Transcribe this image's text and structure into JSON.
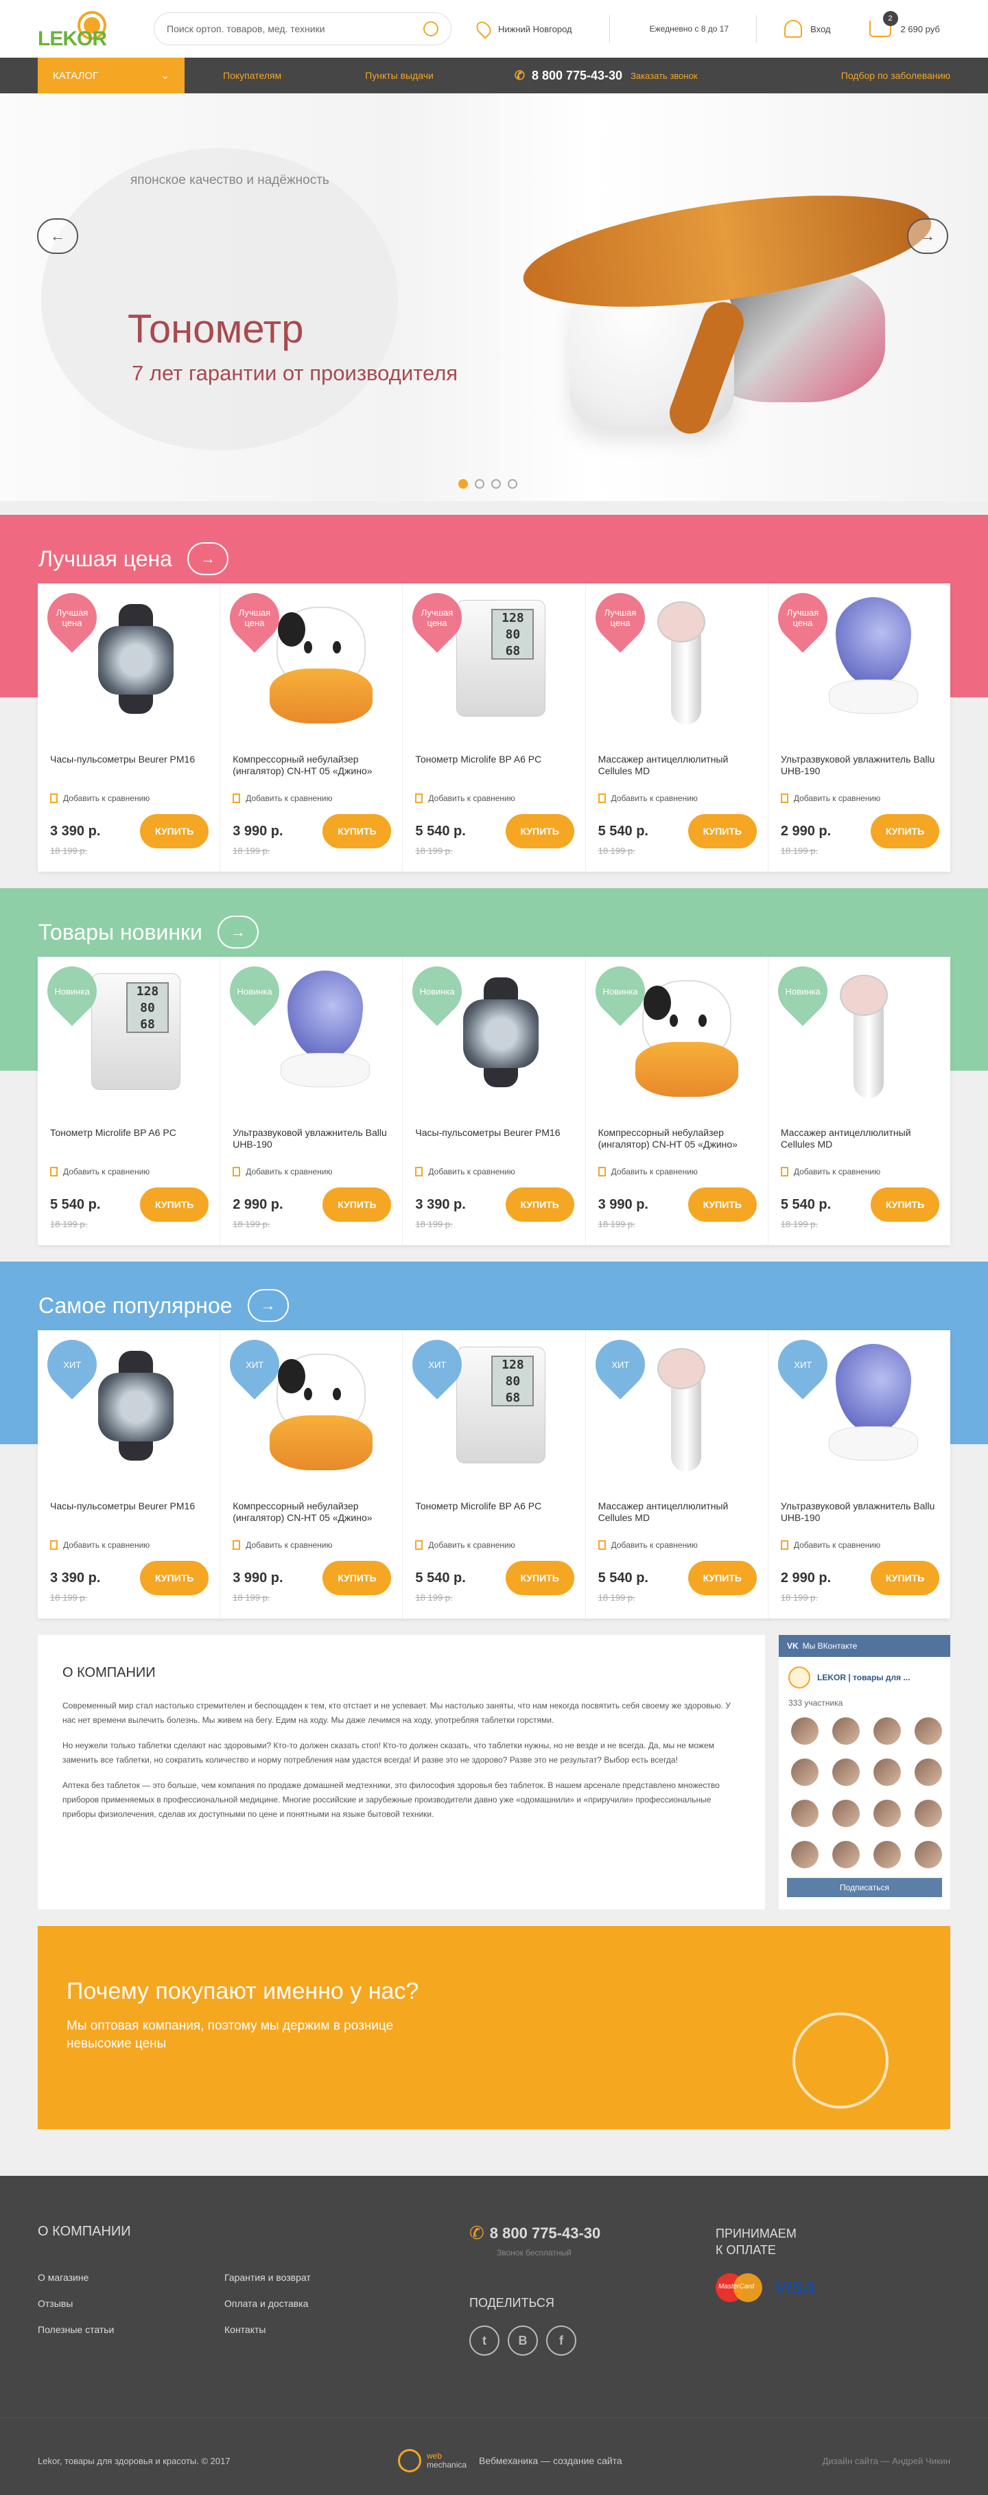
{
  "header": {
    "logo": "LEKOR",
    "search_placeholder": "Поиск ортоп. товаров, мед. техники",
    "city": "Нижний Новгород",
    "hours": "Ежедневно с 8 до 17",
    "login": "Вход",
    "cart_count": "2",
    "cart_total": "2 690 руб"
  },
  "nav": {
    "catalog": "КАТАЛОГ",
    "buyers": "Покупателям",
    "pickup": "Пункты выдачи",
    "phone": "8 800 775-43-30",
    "call": "Заказать звонок",
    "by_disease": "Подбор по заболеванию"
  },
  "hero": {
    "tagline": "японское качество и надёжность",
    "title": "Тонометр",
    "subtitle": "7 лет гарантии от производителя",
    "active_slide": 1,
    "slide_count": 4
  },
  "labels": {
    "compare": "Добавить к сравнению",
    "buy": "КУПИТЬ",
    "old_price": "18 199 р."
  },
  "sections": [
    {
      "title": "Лучшая цена",
      "color": "#ef6a80",
      "badge": "Лучшая цена",
      "products": [
        {
          "name": "Часы-пульсометры Beurer PM16",
          "price": "3 390 р.",
          "img": "watch"
        },
        {
          "name": "Компрессорный небулайзер (ингалятор) CN-HT 05 «Джино»",
          "price": "3 990 р.",
          "img": "cow"
        },
        {
          "name": "Тонометр Microlife BP A6 PC",
          "price": "5 540 р.",
          "img": "bpm"
        },
        {
          "name": "Массажер антицеллюлитный Cellules MD",
          "price": "5 540 р.",
          "img": "mass"
        },
        {
          "name": "Ультразвуковой увлажнитель Ballu UHB-190",
          "price": "2 990 р.",
          "img": "hum"
        }
      ]
    },
    {
      "title": "Товары новинки",
      "color": "#8fcfa7",
      "badge": "Новинка",
      "products": [
        {
          "name": "Тонометр Microlife BP A6 PC",
          "price": "5 540 р.",
          "img": "bpm"
        },
        {
          "name": "Ультразвуковой увлажнитель Ballu UHB-190",
          "price": "2 990 р.",
          "img": "hum"
        },
        {
          "name": "Часы-пульсометры Beurer PM16",
          "price": "3 390 р.",
          "img": "watch"
        },
        {
          "name": "Компрессорный небулайзер (ингалятор) CN-HT 05 «Джино»",
          "price": "3 990 р.",
          "img": "cow"
        },
        {
          "name": "Массажер антицеллюлитный Cellules MD",
          "price": "5 540 р.",
          "img": "mass"
        }
      ]
    },
    {
      "title": "Самое популярное",
      "color": "#6dafe0",
      "badge": "ХИТ",
      "products": [
        {
          "name": "Часы-пульсометры Beurer PM16",
          "price": "3 390 р.",
          "img": "watch"
        },
        {
          "name": "Компрессорный небулайзер (ингалятор) CN-HT 05 «Джино»",
          "price": "3 990 р.",
          "img": "cow"
        },
        {
          "name": "Тонометр Microlife BP A6 PC",
          "price": "5 540 р.",
          "img": "bpm"
        },
        {
          "name": "Массажер антицеллюлитный Cellules MD",
          "price": "5 540 р.",
          "img": "mass"
        },
        {
          "name": "Ультразвуковой увлажнитель Ballu UHB-190",
          "price": "2 990 р.",
          "img": "hum"
        }
      ]
    }
  ],
  "about": {
    "title": "О КОМПАНИИ",
    "p1": "Современный мир стал настолько стремителен и беспощаден к тем, кто отстает и не успевает. Мы настолько заняты, что нам некогда посвятить себя своему же здоровью. У нас нет времени вылечить болезнь. Мы живем на бегу. Едим на ходу. Мы даже лечимся на ходу, употребляя таблетки горстями.",
    "p2": "Но неужели только таблетки сделают нас здоровыми? Кто-то должен сказать стоп! Кто-то должен сказать, что таблетки нужны, но не везде и не всегда. Да, мы не можем заменить все таблетки, но сократить количество и норму потребления нам удастся всегда! И разве это не здорово? Разве это не результат? Выбор есть всегда!",
    "p3": "Аптека без таблеток — это больше, чем компания по продаже домашней медтехники, это философия здоровья без таблеток. В нашем арсенале представлено множество приборов применяемых в профессиональной медицине. Многие российские и зарубежные производители давно уже «одомашнили» и «приручили» профессиональные приборы физиолечения, сделав их доступными по цене и понятными на языке бытовой техники."
  },
  "vk": {
    "header": "Мы ВКонтакте",
    "group": "LEKOR | товары для ...",
    "members": "333 участника",
    "subscribe": "Подписаться"
  },
  "why": {
    "title": "Почему покупают именно у нас?",
    "text": "Мы оптовая компания, поэтому мы держим в рознице невысокие цены"
  },
  "footer": {
    "about_title": "О КОМПАНИИ",
    "links": [
      "О магазине",
      "Гарантия и возврат",
      "Отзывы",
      "Оплата и доставка",
      "Полезные статьи",
      "Контакты"
    ],
    "phone": "8 800 775-43-30",
    "phone_note": "Звонок бесплатный",
    "share": "ПОДЕЛИТЬСЯ",
    "pay_title_1": "ПРИНИМАЕМ",
    "pay_title_2": "К ОПЛАТЕ",
    "mastercard": "MasterCard",
    "visa": "VISA",
    "copyright": "Lekor, товары для здоровья и красоты. © 2017",
    "dev_logo_1": "web",
    "dev_logo_2": "mechanica",
    "developer": "Вебмеханика — создание сайта",
    "design": "Дизайн сайта — Андрей Чикин"
  },
  "colors": {
    "accent": "#f5a623",
    "dark": "#464646",
    "pink": "#ef6a80",
    "green": "#8fcfa7",
    "blue": "#6dafe0"
  }
}
